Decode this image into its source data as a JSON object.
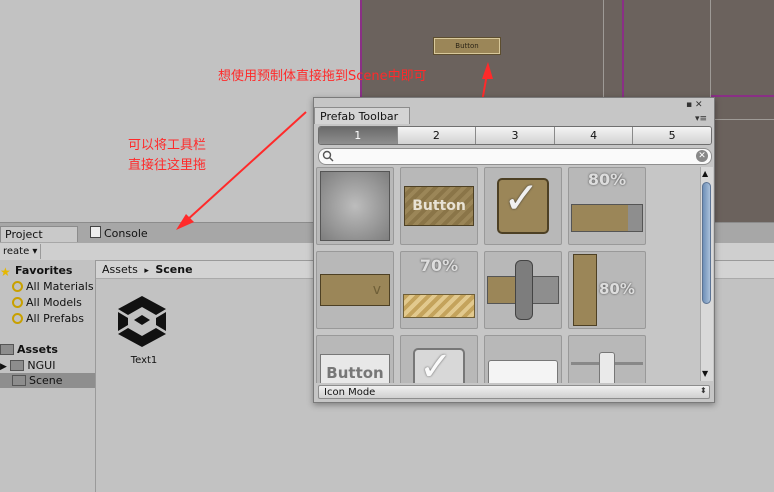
{
  "annotations": {
    "top_note": "想使用预制体直接拖到Scene中即可",
    "left_note_line1": "可以将工具栏",
    "left_note_line2": "直接往这里拖"
  },
  "scene": {
    "button_label": "Button"
  },
  "tabs": {
    "project": "Project",
    "console": "Console"
  },
  "toolbar": {
    "create_label": "reate ▾"
  },
  "tree": {
    "favorites": "Favorites",
    "favorite_items": [
      "All Materials",
      "All Models",
      "All Prefabs"
    ],
    "assets": "Assets",
    "asset_items": [
      "NGUI",
      "Scene"
    ]
  },
  "breadcrumb": {
    "root": "Assets",
    "separator": "▸",
    "current": "Scene"
  },
  "asset_item": {
    "label": "Text1"
  },
  "prefab_window": {
    "title": "Prefab Toolbar",
    "segments": [
      "1",
      "2",
      "3",
      "4",
      "5"
    ],
    "active_segment": "1",
    "search_placeholder": "",
    "grid_labels": {
      "button_1": "Button",
      "progress_80": "80%",
      "progress_70": "70%",
      "vslider_80": "80%",
      "button_2": "Button",
      "popup_v": "v"
    },
    "mode": "Icon Mode"
  },
  "colors": {
    "annotation_red": "#ff2a2a",
    "accent_gold": "#9b8658",
    "scene_bg": "#6b625d",
    "scene_magenta": "#8a2f86"
  }
}
